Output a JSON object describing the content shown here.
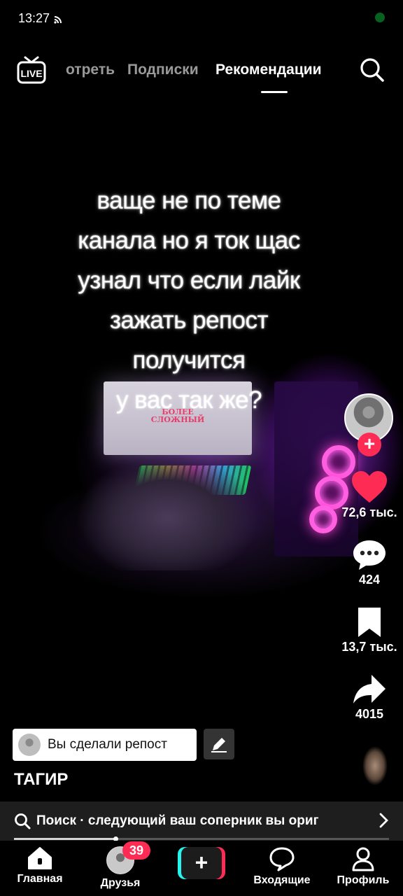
{
  "status_bar": {
    "time": "13:27"
  },
  "top_nav": {
    "live_label": "LIVE",
    "tabs": [
      {
        "label": "отреть",
        "active": false
      },
      {
        "label": "Подписки",
        "active": false
      },
      {
        "label": "Рекомендации",
        "active": true
      }
    ]
  },
  "video": {
    "caption_lines": [
      "ваще не по теме",
      "канала но я ток щас",
      "узнал что если лайк",
      "зажать репост",
      "получится",
      "у вас так же?"
    ],
    "monitor_text_line1": "БОЛЕЕ",
    "monitor_text_line2": "СЛОЖНЫЙ"
  },
  "actions": {
    "likes": "72,6 тыс.",
    "comments": "424",
    "saves": "13,7 тыс.",
    "shares": "4015",
    "like_color": "#fe2c55"
  },
  "repost": {
    "label": "Вы сделали репост"
  },
  "author": "ТАГИР",
  "search_suggestion": {
    "text": "Поиск · следующий ваш соперник вы ориг",
    "progress": 0.27
  },
  "bottom_nav": {
    "home": "Главная",
    "friends": "Друзья",
    "friends_badge": "39",
    "inbox": "Входящие",
    "profile": "Профиль"
  }
}
